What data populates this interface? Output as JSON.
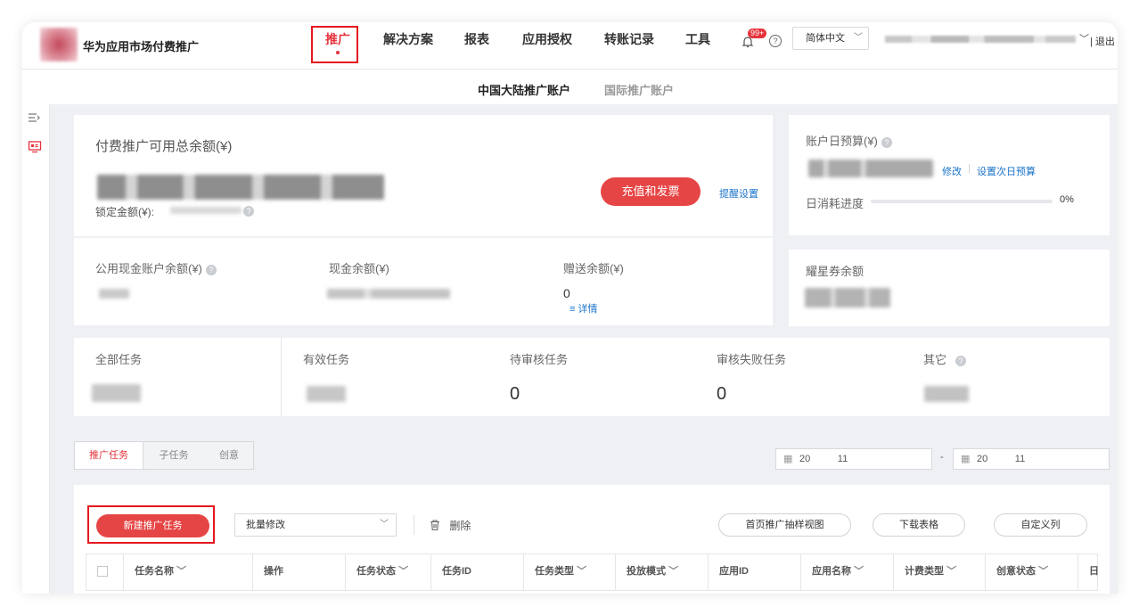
{
  "header": {
    "brand": "华为应用市场付费推广",
    "nav": [
      "推广",
      "解决方案",
      "报表",
      "应用授权",
      "转账记录",
      "工具"
    ],
    "notification_badge": "99+",
    "help_glyph": "?",
    "language": "简体中文",
    "logout": "| 退出"
  },
  "subnav": [
    "中国大陆推广账户",
    "国际推广账户"
  ],
  "balance": {
    "title": "付费推广可用总余额(¥)",
    "locked_label": "锁定金额(¥):",
    "recharge_button": "充值和发票",
    "reminder_link": "提醒设置",
    "public_cash_label": "公用现金账户余额(¥)",
    "cash_label": "现金余额(¥)",
    "gift_label": "赠送余额(¥)",
    "gift_value": "0",
    "detail_link": "≡ 详情"
  },
  "budget": {
    "title": "账户日预算(¥)",
    "modify_link": "修改",
    "separator": "|",
    "next_day_link": "设置次日预算",
    "progress_label": "日消耗进度",
    "progress_value": "0%",
    "progress_fraction": 0
  },
  "voucher": {
    "title": "耀星券余额"
  },
  "task_stats": [
    {
      "label": "全部任务",
      "value": ""
    },
    {
      "label": "有效任务",
      "value": ""
    },
    {
      "label": "待审核任务",
      "value": "0"
    },
    {
      "label": "审核失败任务",
      "value": "0"
    },
    {
      "label": "其它",
      "value": ""
    }
  ],
  "tabs": [
    "推广任务",
    "子任务",
    "创意"
  ],
  "date_range": {
    "start": "20          11",
    "separator": "-",
    "end": "20          11"
  },
  "toolbar": {
    "new_task": "新建推广任务",
    "batch_modify": "批量修改",
    "delete": "删除",
    "sample_view": "首页推广抽样视图",
    "download": "下载表格",
    "custom_columns": "自定义列"
  },
  "table": {
    "columns": [
      "任务名称",
      "操作",
      "任务状态",
      "任务ID",
      "任务类型",
      "投放模式",
      "应用ID",
      "应用名称",
      "计费类型",
      "创意状态",
      "日"
    ]
  },
  "colors": {
    "accent": "#e5333b",
    "link": "#1a73c9",
    "page_bg": "#eef0f4"
  }
}
